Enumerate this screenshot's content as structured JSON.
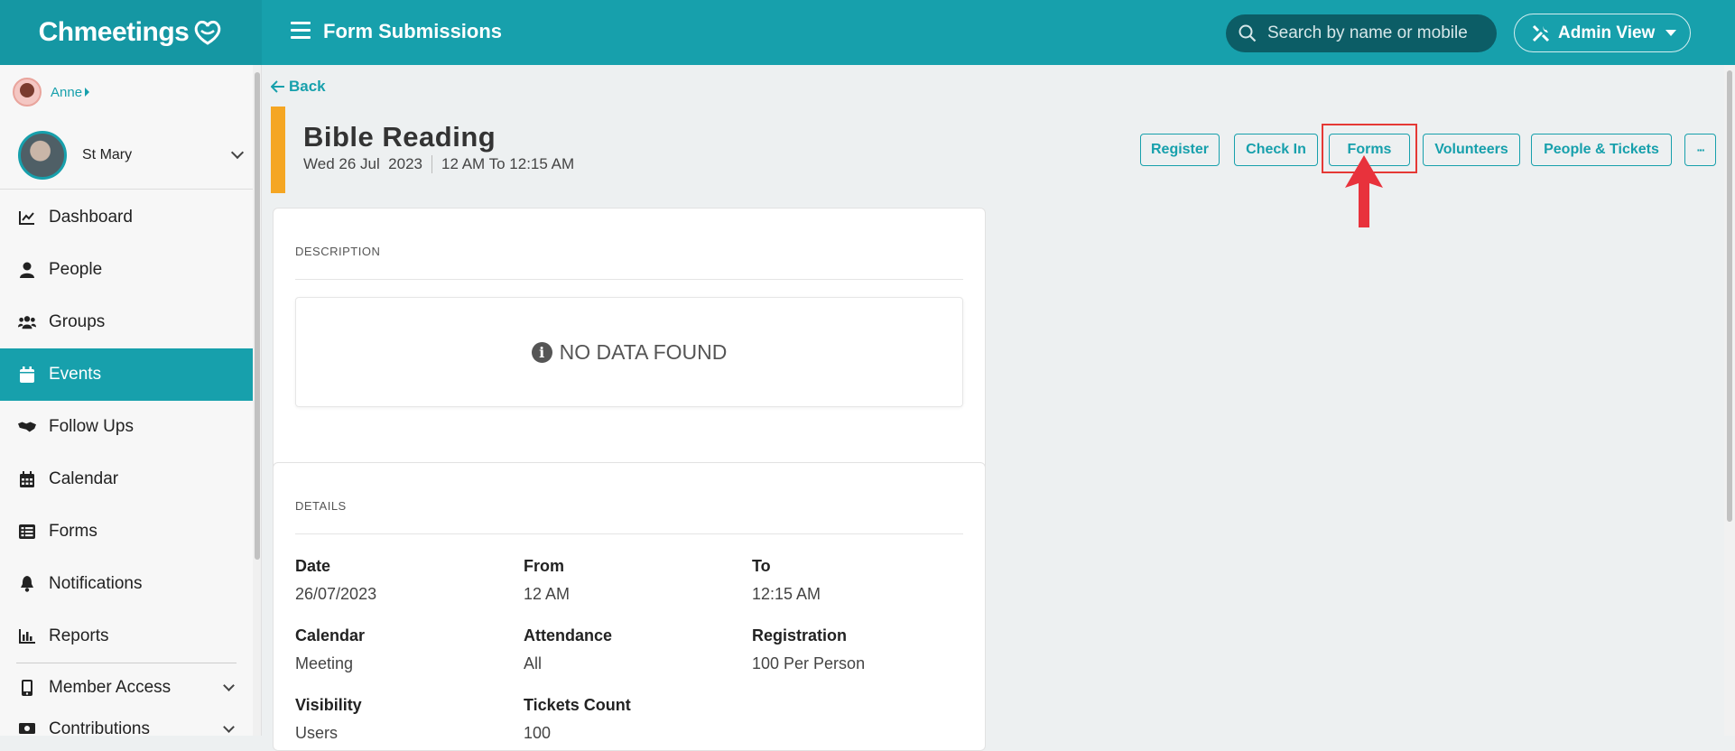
{
  "app": {
    "logo": "Chmeetings",
    "page_title": "Form Submissions",
    "search_placeholder": "Search by name or mobile",
    "admin_view_label": "Admin View"
  },
  "sidebar": {
    "user_name": "Anne",
    "church_name": "St Mary",
    "items": [
      {
        "label": "Dashboard",
        "icon": "chart-line-icon"
      },
      {
        "label": "People",
        "icon": "person-icon"
      },
      {
        "label": "Groups",
        "icon": "users-icon"
      },
      {
        "label": "Events",
        "icon": "calendar-icon",
        "active": true
      },
      {
        "label": "Follow Ups",
        "icon": "handshake-icon"
      },
      {
        "label": "Calendar",
        "icon": "calendar-grid-icon"
      },
      {
        "label": "Forms",
        "icon": "list-icon"
      },
      {
        "label": "Notifications",
        "icon": "bell-icon"
      },
      {
        "label": "Reports",
        "icon": "bar-chart-icon"
      },
      {
        "label": "Member Access",
        "icon": "mobile-icon"
      },
      {
        "label": "Contributions",
        "icon": "money-icon"
      }
    ]
  },
  "event": {
    "back_label": "Back",
    "title": "Bible Reading",
    "date_text": "Wed 26 Jul  2023",
    "time_text": "12 AM To 12:15 AM"
  },
  "actions": {
    "register": "Register",
    "check_in": "Check In",
    "forms": "Forms",
    "volunteers": "Volunteers",
    "people_tickets": "People & Tickets",
    "more": "···"
  },
  "description": {
    "heading": "DESCRIPTION",
    "empty_text": "NO DATA FOUND"
  },
  "details": {
    "heading": "DETAILS",
    "date_label": "Date",
    "date_value": "26/07/2023",
    "from_label": "From",
    "from_value": "12 AM",
    "to_label": "To",
    "to_value": "12:15 AM",
    "calendar_label": "Calendar",
    "calendar_value": "Meeting",
    "attendance_label": "Attendance",
    "attendance_value": "All",
    "registration_label": "Registration",
    "registration_value": "100 Per Person",
    "visibility_label": "Visibility",
    "visibility_value": "Users",
    "tickets_label": "Tickets Count",
    "tickets_value": "100"
  },
  "colors": {
    "brand": "#17a0ac",
    "accent": "#f5a623",
    "highlight": "#e53935"
  }
}
